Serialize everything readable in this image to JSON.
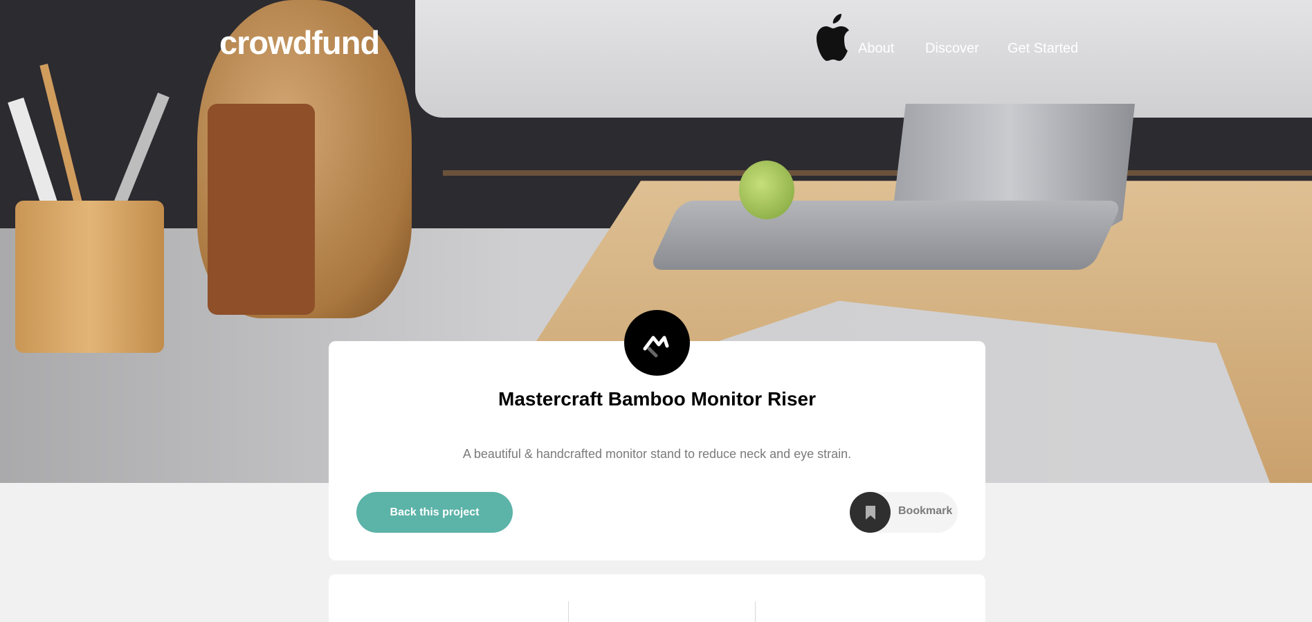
{
  "header": {
    "logo": "crowdfund",
    "nav": [
      {
        "label": "About"
      },
      {
        "label": "Discover"
      },
      {
        "label": "Get Started"
      }
    ]
  },
  "project": {
    "title": "Mastercraft Bamboo Monitor Riser",
    "description": "A beautiful & handcrafted monitor stand to reduce neck and eye strain.",
    "back_label": "Back this project",
    "bookmark_label": "Bookmark"
  },
  "colors": {
    "accent": "#5cb3a8",
    "page_background": "#f1f1f1",
    "card_background": "#ffffff"
  },
  "icons": {
    "project_logo": "mastercraft-logo-icon",
    "bookmark": "bookmark-icon"
  }
}
